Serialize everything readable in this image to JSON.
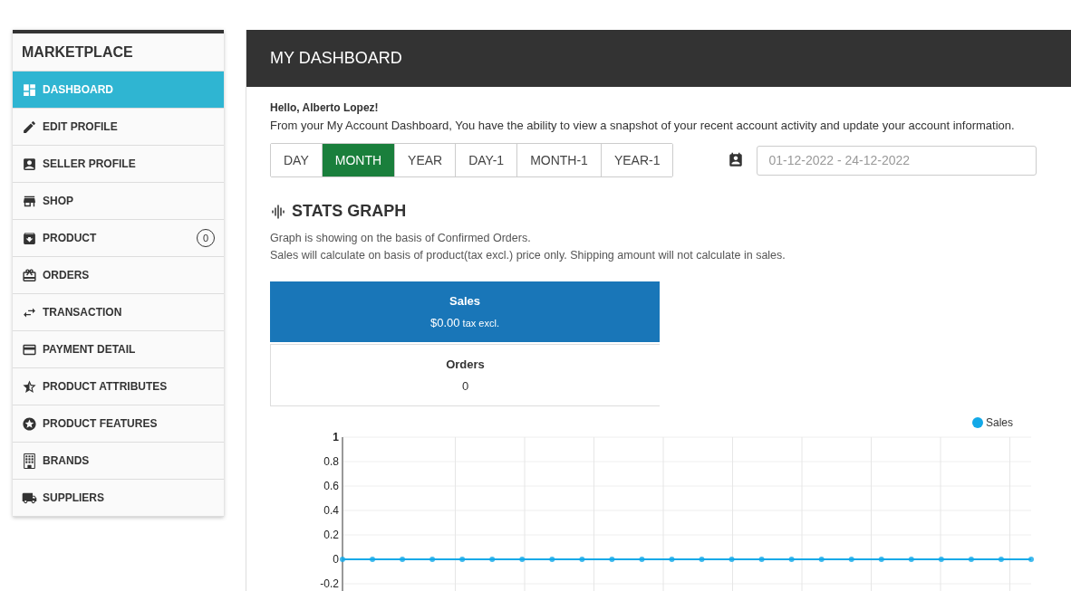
{
  "sidebar": {
    "title": "MARKETPLACE",
    "items": [
      {
        "label": "DASHBOARD",
        "selected": true
      },
      {
        "label": "EDIT PROFILE",
        "selected": false
      },
      {
        "label": "SELLER PROFILE",
        "selected": false
      },
      {
        "label": "SHOP",
        "selected": false
      },
      {
        "label": "PRODUCT",
        "selected": false,
        "badge": "0"
      },
      {
        "label": "ORDERS",
        "selected": false
      },
      {
        "label": "TRANSACTION",
        "selected": false
      },
      {
        "label": "PAYMENT DETAIL",
        "selected": false
      },
      {
        "label": "PRODUCT ATTRIBUTES",
        "selected": false
      },
      {
        "label": "PRODUCT FEATURES",
        "selected": false
      },
      {
        "label": "BRANDS",
        "selected": false
      },
      {
        "label": "SUPPLIERS",
        "selected": false
      }
    ]
  },
  "main": {
    "title": "MY DASHBOARD",
    "greeting": "Hello, Alberto Lopez!",
    "intro": "From your My Account Dashboard, You have the ability to view a snapshot of your recent account activity and update your account information.",
    "periods": [
      {
        "label": "DAY",
        "selected": false
      },
      {
        "label": "MONTH",
        "selected": true
      },
      {
        "label": "YEAR",
        "selected": false
      },
      {
        "label": "DAY-1",
        "selected": false
      },
      {
        "label": "MONTH-1",
        "selected": false
      },
      {
        "label": "YEAR-1",
        "selected": false
      }
    ],
    "date_range": {
      "placeholder": "01-12-2022 - 24-12-2022"
    },
    "stats": {
      "title": "STATS GRAPH",
      "notes": [
        "Graph is showing on the basis of Confirmed Orders.",
        "Sales will calculate on basis of product(tax excl.) price only. Shipping amount will not calculate in sales."
      ],
      "summary": [
        {
          "label": "Sales",
          "value": "$0.00",
          "unit": "tax excl.",
          "selected": true
        },
        {
          "label": "Orders",
          "value": "0",
          "selected": false
        }
      ],
      "chart_data": {
        "type": "line",
        "grid": true,
        "ylim": [
          -0.2,
          1
        ],
        "yticks": [
          -0.2,
          0,
          0.2,
          0.4,
          0.6,
          0.8,
          1
        ],
        "series": [
          {
            "name": "Sales",
            "color": "#13a9e8",
            "marker": true,
            "values": [
              0,
              0,
              0,
              0,
              0,
              0,
              0,
              0,
              0,
              0,
              0,
              0,
              0,
              0,
              0,
              0,
              0,
              0,
              0,
              0,
              0,
              0,
              0,
              0
            ]
          }
        ]
      }
    }
  }
}
